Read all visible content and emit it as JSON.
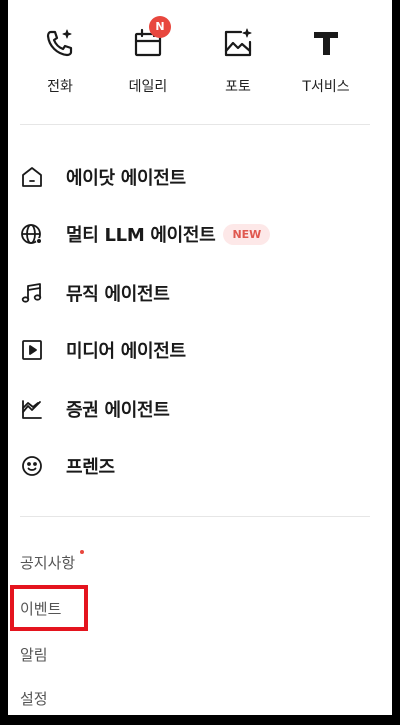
{
  "quick_menu": [
    {
      "label": "전화",
      "icon": "phone-sparkle-icon"
    },
    {
      "label": "데일리",
      "icon": "calendar-icon",
      "badge": "N"
    },
    {
      "label": "포토",
      "icon": "photo-sparkle-icon"
    },
    {
      "label": "T서비스",
      "icon": "t-logo-icon"
    }
  ],
  "menu": [
    {
      "label": "에이닷 에이전트",
      "icon": "home-icon"
    },
    {
      "label": "멀티 LLM 에이전트",
      "icon": "globe-icon",
      "badge": "NEW"
    },
    {
      "label": "뮤직 에이전트",
      "icon": "music-note-icon"
    },
    {
      "label": "미디어 에이전트",
      "icon": "play-square-icon"
    },
    {
      "label": "증권 에이전트",
      "icon": "stock-chart-icon"
    },
    {
      "label": "프렌즈",
      "icon": "smiley-icon"
    }
  ],
  "footer": [
    {
      "label": "공지사항",
      "has_dot": true
    },
    {
      "label": "이벤트"
    },
    {
      "label": "알림"
    },
    {
      "label": "설정"
    }
  ],
  "colors": {
    "accent": "#e8473e",
    "highlight": "#e4141e",
    "text": "#1a1a1a",
    "muted": "#555555"
  }
}
